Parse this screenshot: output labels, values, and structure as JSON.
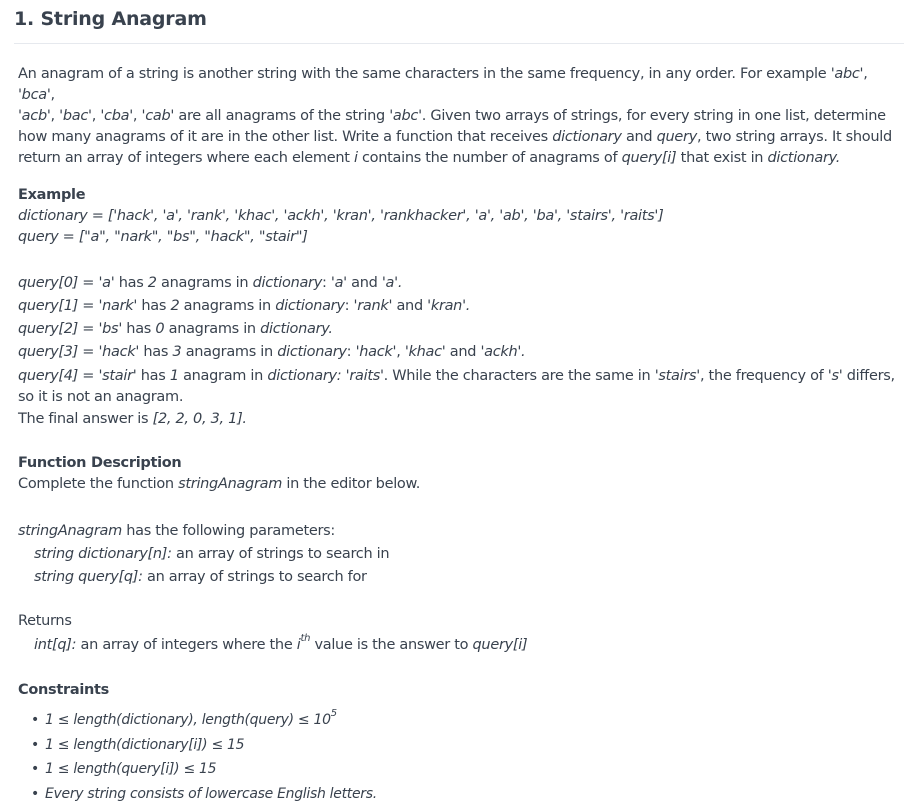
{
  "title": "1. String Anagram",
  "intro": {
    "t1": "An anagram of a string is another string with the same characters in the same frequency, in any order. For example ",
    "abc": "'abc'",
    "c1": ", ",
    "bca": "'bca'",
    "c2": ",",
    "acb": "'acb'",
    "c3": ", ",
    "bac": "'bac'",
    "c4": ", ",
    "cba": "'cba'",
    "c5": ", ",
    "cab": "'cab'",
    "t2": " are all anagrams of the string ",
    "abc2": "'abc'",
    "t3": ". Given two arrays of strings, for every string in one list, determine how many anagrams of it are in the other list. Write a function that receives ",
    "dictionary": "dictionary",
    "t4": " and ",
    "query": "query",
    "t5": ", two string arrays. It should return an array of integers where each element ",
    "i": "i",
    "t6": " contains the number of anagrams of ",
    "queryi": "query[i]",
    "t7": " that exist in ",
    "dictionary2": "dictionary."
  },
  "example": {
    "heading": "Example",
    "dictionary_line": "dictionary = ['hack', 'a', 'rank', 'khac', 'ackh', 'kran', 'rankhacker', 'a', 'ab', 'ba', 'stairs', 'raits']",
    "query_line": "query = [\"a\", \"nark\", \"bs\", \"hack\", \"stair\"]",
    "q0": {
      "a": "query[0]",
      "b": " = ",
      "c": "'a'",
      "d": " has ",
      "e": "2",
      "f": " anagrams in ",
      "g": "dictionary",
      "h": ": ",
      "i": "'a'",
      "j": " and ",
      "k": "'a'."
    },
    "q1": {
      "a": "query[1]",
      "b": " = ",
      "c": "'nark'",
      "d": " has ",
      "e": "2",
      "f": " anagrams in ",
      "g": "dictionary",
      "h": ": ",
      "i": "'rank'",
      "j": " and ",
      "k": "'kran'."
    },
    "q2": {
      "a": "query[2]",
      "b": " = ",
      "c": "'bs'",
      "d": " has ",
      "e": "0",
      "f": " anagrams in ",
      "g": "dictionary."
    },
    "q3": {
      "a": "query[3]",
      "b": " = ",
      "c": "'hack'",
      "d": " has ",
      "e": "3",
      "f": " anagrams in ",
      "g": "dictionary",
      "h": ": ",
      "i": "'hack'",
      "j": ", ",
      "k": "'khac'",
      "l": " and ",
      "m": "'ackh'."
    },
    "q4": {
      "a": "query[4]",
      "b": " = ",
      "c": "'stair'",
      "d": " has ",
      "e": "1",
      "f": " anagram in ",
      "g": "dictionary: 'raits'",
      "h": ". While the characters are the same in ",
      "i": "'stairs'",
      "j": ", the frequency of ",
      "k": "'s'",
      "l": " differs, so it is not an anagram."
    },
    "final": {
      "a": "The final answer is ",
      "b": "[2, 2, 0, 3, 1]."
    }
  },
  "function_description": {
    "heading": "Function Description",
    "t1": "Complete the function ",
    "fname": "stringAnagram",
    "t2": " in the editor below.",
    "params_fname": "stringAnagram",
    "params_t": " has the following parameters:",
    "p1_sig": "string dictionary[n]:",
    "p1_desc": " an array of strings to search in",
    "p2_sig": "string query[q]:",
    "p2_desc": " an array of strings to search for",
    "returns_label": "Returns",
    "ret_sig": "int[q]:",
    "ret_desc1": " an array of integers where the ",
    "ret_i": "i",
    "ret_th": "th",
    "ret_desc2": " value is the answer to ",
    "ret_q": "query[i]"
  },
  "constraints": {
    "heading": "Constraints",
    "bullet": "•",
    "c1_a": "1 ≤ length(dictionary), length(query) ≤ 10",
    "c1_sup": "5",
    "c2": "1 ≤ length(dictionary[i]) ≤ 15",
    "c3": "1 ≤ length(query[i]) ≤ 15",
    "c4": "Every string consists of lowercase English letters."
  },
  "colors": {
    "text": "#39424e",
    "rule": "#e6e9ee",
    "background": "#ffffff"
  }
}
